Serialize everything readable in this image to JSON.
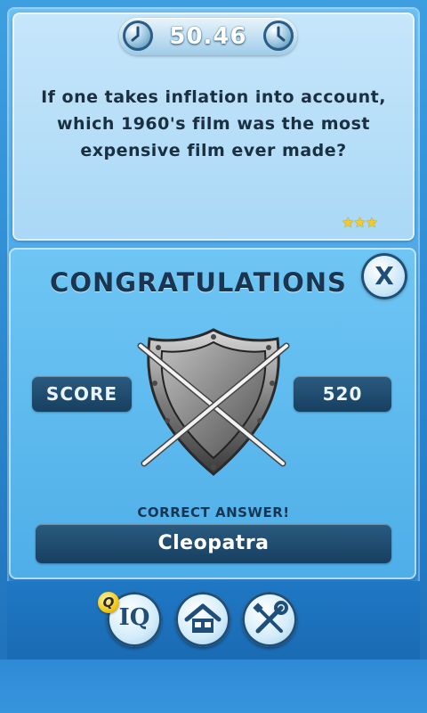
{
  "timer": {
    "value": "50.46",
    "left_icon": "stopwatch-icon",
    "right_icon": "stopwatch-icon"
  },
  "question": {
    "text": "If one takes inflation into account, which 1960's film was the most expensive film ever made?",
    "difficulty_stars": "★★★",
    "difficulty_level": 3
  },
  "result": {
    "title": "CONGRATULATIONS",
    "close_label": "X",
    "score_label": "SCORE",
    "score_value": "520",
    "emblem_icon": "shield-crossed-swords-icon",
    "correct_label": "CORRECT ANSWER!",
    "answer": "Cleopatra"
  },
  "nav": {
    "iq_label": "IQ",
    "iq_badge": "Q",
    "home_icon": "home-icon",
    "settings_icon": "tools-icon"
  },
  "colors": {
    "background": "#2f8bd2",
    "panel": "#a9d8f6",
    "dark_pill": "#173f60",
    "star": "#f6cc22"
  }
}
